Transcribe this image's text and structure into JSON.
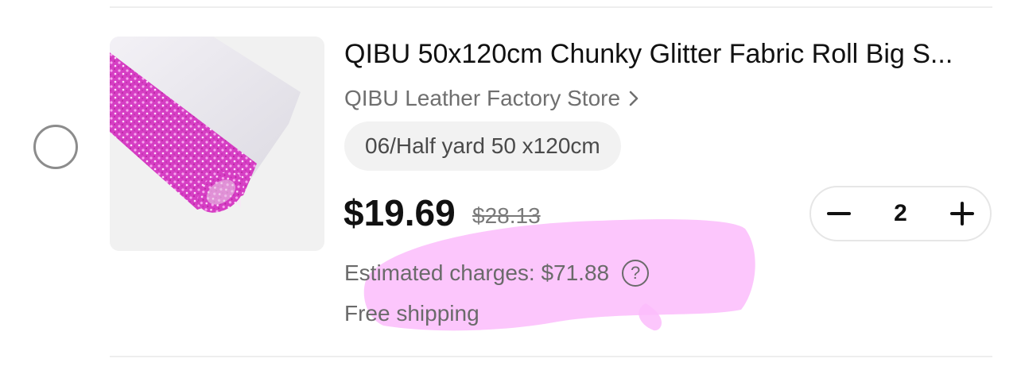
{
  "item": {
    "title": "QIBU 50x120cm Chunky Glitter Fabric Roll Big S...",
    "store": "QIBU Leather Factory Store",
    "variant": "06/Half yard 50 x120cm",
    "price": "$19.69",
    "original_price": "$28.13",
    "quantity": "2",
    "estimated_charges": "Estimated charges: $71.88",
    "help_symbol": "?",
    "shipping": "Free shipping",
    "selected": false
  },
  "icons": {
    "store_chevron": "chevron-right-icon",
    "decrease": "minus-icon",
    "increase": "plus-icon",
    "help": "question-circle-icon"
  },
  "colors": {
    "highlight": "#fbbcfb",
    "glitter": "#e040c8",
    "text_primary": "#111111",
    "text_secondary": "#6a6a6a"
  }
}
